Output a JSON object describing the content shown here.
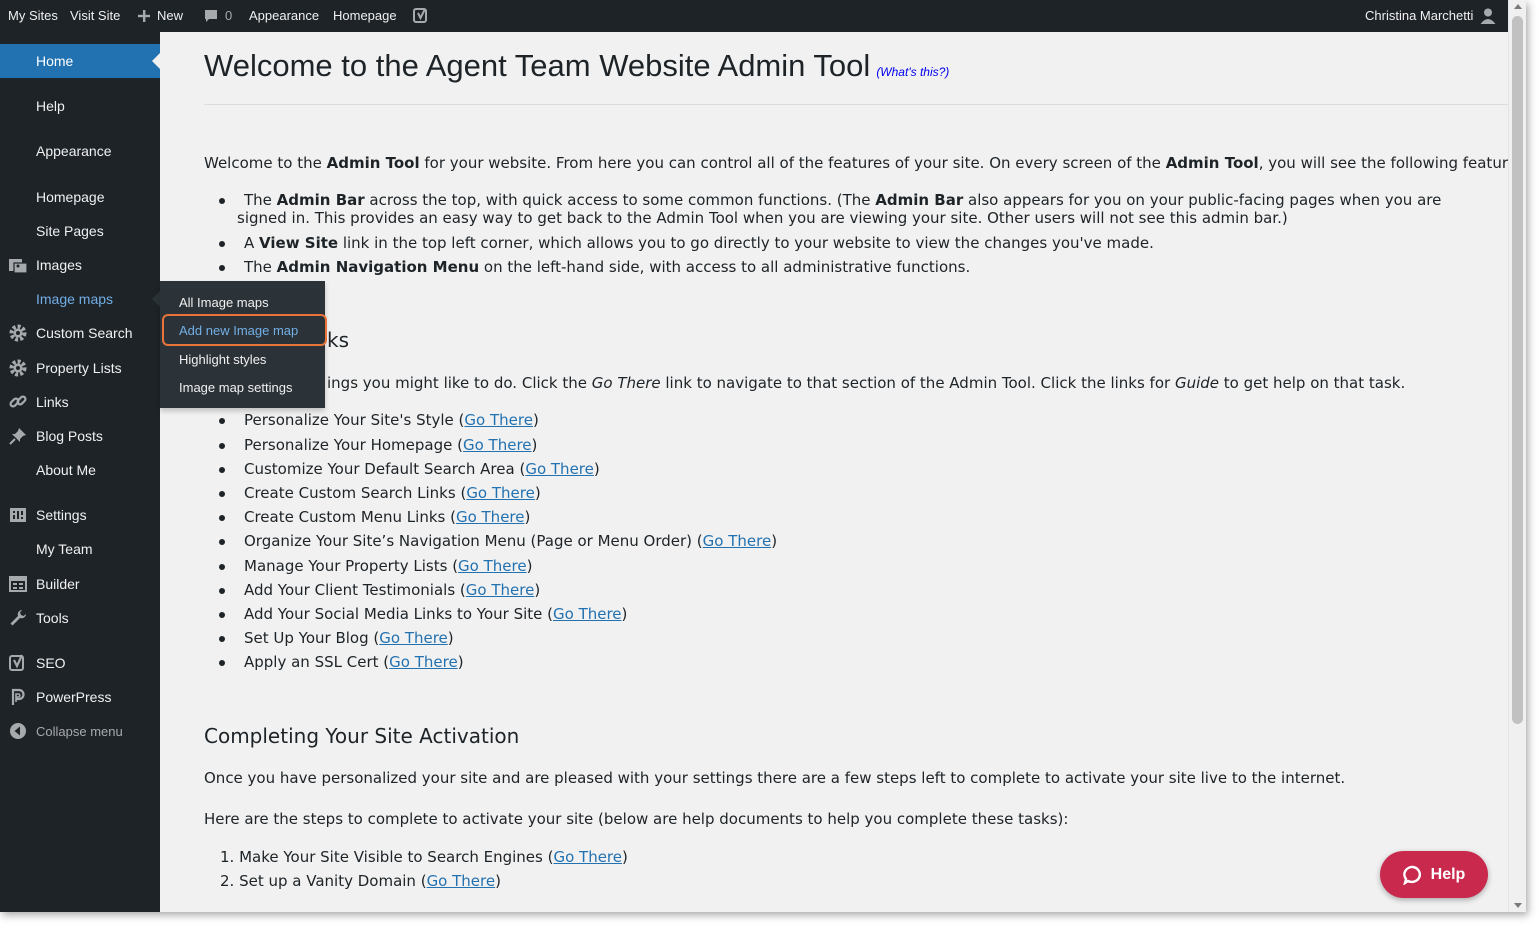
{
  "admin_bar": {
    "my_sites": "My Sites",
    "visit_site": "Visit Site",
    "new": "New",
    "comments_count": "0",
    "appearance": "Appearance",
    "homepage": "Homepage",
    "user_name": "Christina Marchetti"
  },
  "sidebar": {
    "items": [
      {
        "label": "Home",
        "icon": "none"
      },
      {
        "label": "Help",
        "icon": "none"
      },
      {
        "label": "Appearance",
        "icon": "none"
      },
      {
        "label": "Homepage",
        "icon": "none"
      },
      {
        "label": "Site Pages",
        "icon": "none"
      },
      {
        "label": "Images",
        "icon": "images-icon"
      },
      {
        "label": "Image maps",
        "icon": "none"
      },
      {
        "label": "Custom Search",
        "icon": "gear-icon"
      },
      {
        "label": "Property Lists",
        "icon": "gear-icon"
      },
      {
        "label": "Links",
        "icon": "link-icon"
      },
      {
        "label": "Blog Posts",
        "icon": "pin-icon"
      },
      {
        "label": "About Me",
        "icon": "none"
      },
      {
        "label": "Settings",
        "icon": "settings-icon"
      },
      {
        "label": "My Team",
        "icon": "none"
      },
      {
        "label": "Builder",
        "icon": "builder-icon"
      },
      {
        "label": "Tools",
        "icon": "wrench-icon"
      },
      {
        "label": "SEO",
        "icon": "yoast-icon"
      },
      {
        "label": "PowerPress",
        "icon": "powerpress-icon"
      },
      {
        "label": "Collapse menu",
        "icon": "collapse-icon"
      }
    ]
  },
  "flyout": {
    "items": [
      "All Image maps",
      "Add new Image map",
      "Highlight styles",
      "Image map settings"
    ]
  },
  "main": {
    "title": "Welcome to the Agent Team Website Admin Tool",
    "whats_this": "(What's this?)",
    "intro": {
      "t1": "Welcome to the ",
      "b1": "Admin Tool",
      "t2": " for your website. From here you can control all of the features of your site. On every screen of the ",
      "b2": "Admin Tool",
      "t3": ", you will see the following features:"
    },
    "features": {
      "f1_t1": "The ",
      "f1_b1": "Admin Bar",
      "f1_t2": " across the top, with quick access to some common functions. (The ",
      "f1_b2": "Admin Bar",
      "f1_t3": " also appears for you on your public-facing pages when you are signed in. This provides an easy way to get back to the Admin Tool when you are viewing your site. Other users will not see this admin bar.)",
      "f2_t1": "A ",
      "f2_b1": "View Site",
      "f2_t2": " link in the top left corner, which allows you to go directly to your website to view the changes you've made.",
      "f3_t1": "The ",
      "f3_b1": "Admin Navigation Menu",
      "f3_t2": " on the left-hand side, with access to all administrative functions."
    },
    "tasks_heading_partial": "ks",
    "tasks_intro": {
      "t1": "ings you might like to do. Click the ",
      "i1": "Go There",
      "t2": " link to navigate to that section of the Admin Tool. Click the links for ",
      "i2": "Guide",
      "t3": " to get help on that task."
    },
    "go_there": "Go There",
    "tasks": [
      "Personalize Your Site's Style",
      "Personalize Your Homepage",
      "Customize Your Default Search Area",
      "Create Custom Search Links",
      "Create Custom Menu Links",
      "Organize Your Site’s Navigation Menu (Page or Menu Order)",
      "Manage Your Property Lists",
      "Add Your Client Testimonials",
      "Add Your Social Media Links to Your Site",
      "Set Up Your Blog",
      "Apply an SSL Cert"
    ],
    "activation_heading": "Completing Your Site Activation",
    "activation_p1": "Once you have personalized your site and are pleased with your settings there are a few steps left to complete to activate your site live to the internet.",
    "activation_p2": "Here are the steps to complete to activate your site (below are help documents to help you complete these tasks):",
    "steps": [
      "1. Make Your Site Visible to Search Engines",
      "2. Set up a Vanity Domain"
    ]
  },
  "help_button": "Help",
  "colors": {
    "sidebar_bg": "#1d2327",
    "current_bg": "#2271b1",
    "link": "#2271b1",
    "highlight": "#e8743b",
    "help_bg": "#c8294d"
  }
}
